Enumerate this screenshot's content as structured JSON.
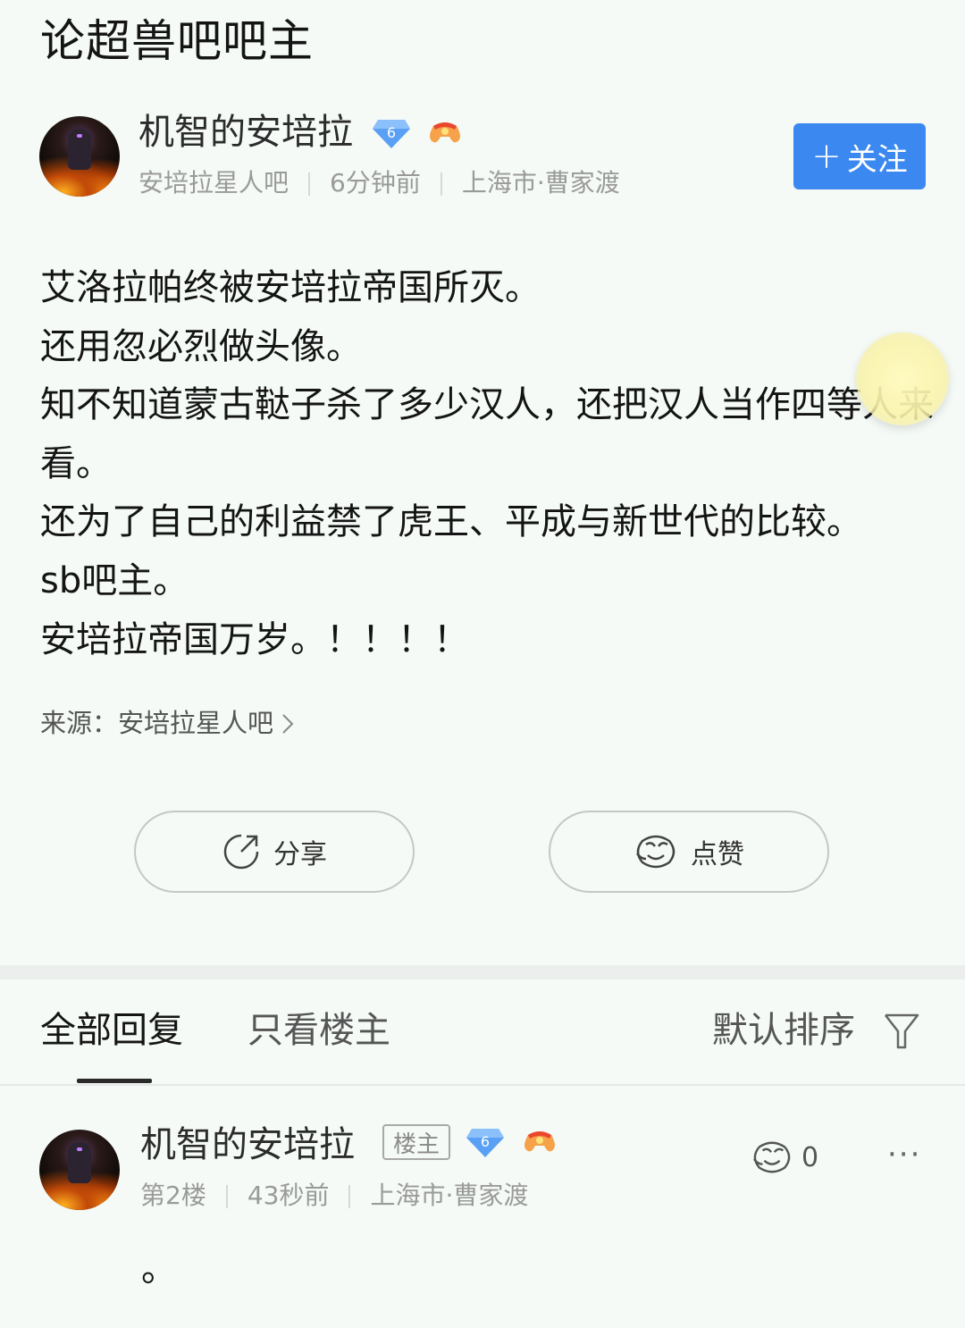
{
  "post": {
    "title": "论超兽吧吧主",
    "author": {
      "name": "机智的安培拉",
      "level": "6",
      "forum": "安培拉星人吧",
      "time": "6分钟前",
      "location": "上海市·曹家渡"
    },
    "follow_label": "关注",
    "follow_icon": "+",
    "content_lines": [
      "艾洛拉帕终被安培拉帝国所灭。",
      "还用忽必烈做头像。",
      "知不知道蒙古鞑子杀了多少汉人，还把汉人当作四等人来看。",
      "还为了自己的利益禁了虎王、平成与新世代的比较。",
      "sb吧主。",
      "安培拉帝国万岁。！！！！"
    ],
    "source_label": "来源：",
    "source_name": "安培拉星人吧",
    "share_label": "分享",
    "like_label": "点赞"
  },
  "replies_bar": {
    "tab_all": "全部回复",
    "tab_op_only": "只看楼主",
    "sort_label": "默认排序"
  },
  "reply": {
    "author_name": "机智的安培拉",
    "op_tag": "楼主",
    "level": "6",
    "floor": "第2楼",
    "time": "43秒前",
    "location": "上海市·曹家渡",
    "like_count": "0",
    "more": "···",
    "text": "。"
  },
  "colors": {
    "background": "#f5faf6",
    "accent_blue": "#3a88f0",
    "meta_gray": "#9a9a9a"
  },
  "icons": {
    "level_badge": "diamond-level-icon",
    "game_badge": "game-controller-icon",
    "share": "share-icon",
    "like": "like-face-icon",
    "filter": "filter-icon",
    "source_arrow": "chevron-right-icon"
  }
}
